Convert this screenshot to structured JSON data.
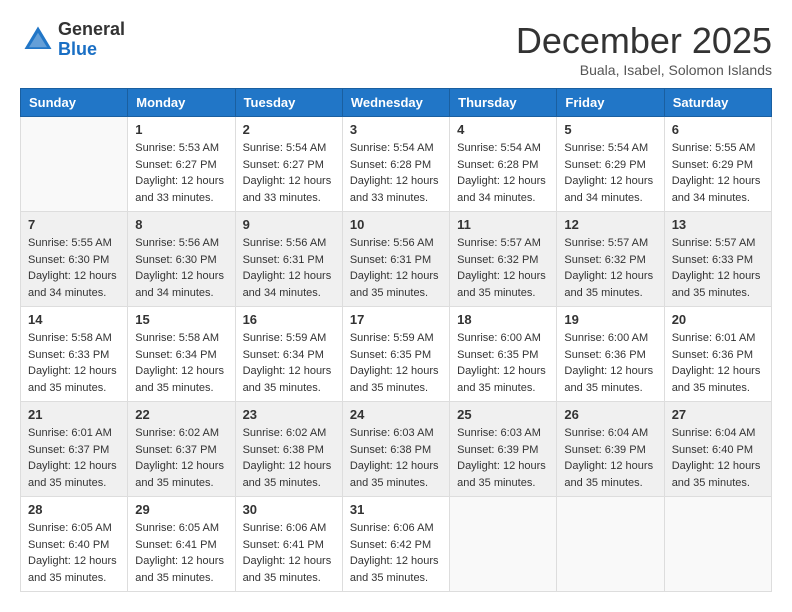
{
  "header": {
    "logo_line1": "General",
    "logo_line2": "Blue",
    "month": "December 2025",
    "location": "Buala, Isabel, Solomon Islands"
  },
  "days_of_week": [
    "Sunday",
    "Monday",
    "Tuesday",
    "Wednesday",
    "Thursday",
    "Friday",
    "Saturday"
  ],
  "weeks": [
    [
      {
        "day": "",
        "info": []
      },
      {
        "day": "1",
        "info": [
          "Sunrise: 5:53 AM",
          "Sunset: 6:27 PM",
          "Daylight: 12 hours",
          "and 33 minutes."
        ]
      },
      {
        "day": "2",
        "info": [
          "Sunrise: 5:54 AM",
          "Sunset: 6:27 PM",
          "Daylight: 12 hours",
          "and 33 minutes."
        ]
      },
      {
        "day": "3",
        "info": [
          "Sunrise: 5:54 AM",
          "Sunset: 6:28 PM",
          "Daylight: 12 hours",
          "and 33 minutes."
        ]
      },
      {
        "day": "4",
        "info": [
          "Sunrise: 5:54 AM",
          "Sunset: 6:28 PM",
          "Daylight: 12 hours",
          "and 34 minutes."
        ]
      },
      {
        "day": "5",
        "info": [
          "Sunrise: 5:54 AM",
          "Sunset: 6:29 PM",
          "Daylight: 12 hours",
          "and 34 minutes."
        ]
      },
      {
        "day": "6",
        "info": [
          "Sunrise: 5:55 AM",
          "Sunset: 6:29 PM",
          "Daylight: 12 hours",
          "and 34 minutes."
        ]
      }
    ],
    [
      {
        "day": "7",
        "info": [
          "Sunrise: 5:55 AM",
          "Sunset: 6:30 PM",
          "Daylight: 12 hours",
          "and 34 minutes."
        ]
      },
      {
        "day": "8",
        "info": [
          "Sunrise: 5:56 AM",
          "Sunset: 6:30 PM",
          "Daylight: 12 hours",
          "and 34 minutes."
        ]
      },
      {
        "day": "9",
        "info": [
          "Sunrise: 5:56 AM",
          "Sunset: 6:31 PM",
          "Daylight: 12 hours",
          "and 34 minutes."
        ]
      },
      {
        "day": "10",
        "info": [
          "Sunrise: 5:56 AM",
          "Sunset: 6:31 PM",
          "Daylight: 12 hours",
          "and 35 minutes."
        ]
      },
      {
        "day": "11",
        "info": [
          "Sunrise: 5:57 AM",
          "Sunset: 6:32 PM",
          "Daylight: 12 hours",
          "and 35 minutes."
        ]
      },
      {
        "day": "12",
        "info": [
          "Sunrise: 5:57 AM",
          "Sunset: 6:32 PM",
          "Daylight: 12 hours",
          "and 35 minutes."
        ]
      },
      {
        "day": "13",
        "info": [
          "Sunrise: 5:57 AM",
          "Sunset: 6:33 PM",
          "Daylight: 12 hours",
          "and 35 minutes."
        ]
      }
    ],
    [
      {
        "day": "14",
        "info": [
          "Sunrise: 5:58 AM",
          "Sunset: 6:33 PM",
          "Daylight: 12 hours",
          "and 35 minutes."
        ]
      },
      {
        "day": "15",
        "info": [
          "Sunrise: 5:58 AM",
          "Sunset: 6:34 PM",
          "Daylight: 12 hours",
          "and 35 minutes."
        ]
      },
      {
        "day": "16",
        "info": [
          "Sunrise: 5:59 AM",
          "Sunset: 6:34 PM",
          "Daylight: 12 hours",
          "and 35 minutes."
        ]
      },
      {
        "day": "17",
        "info": [
          "Sunrise: 5:59 AM",
          "Sunset: 6:35 PM",
          "Daylight: 12 hours",
          "and 35 minutes."
        ]
      },
      {
        "day": "18",
        "info": [
          "Sunrise: 6:00 AM",
          "Sunset: 6:35 PM",
          "Daylight: 12 hours",
          "and 35 minutes."
        ]
      },
      {
        "day": "19",
        "info": [
          "Sunrise: 6:00 AM",
          "Sunset: 6:36 PM",
          "Daylight: 12 hours",
          "and 35 minutes."
        ]
      },
      {
        "day": "20",
        "info": [
          "Sunrise: 6:01 AM",
          "Sunset: 6:36 PM",
          "Daylight: 12 hours",
          "and 35 minutes."
        ]
      }
    ],
    [
      {
        "day": "21",
        "info": [
          "Sunrise: 6:01 AM",
          "Sunset: 6:37 PM",
          "Daylight: 12 hours",
          "and 35 minutes."
        ]
      },
      {
        "day": "22",
        "info": [
          "Sunrise: 6:02 AM",
          "Sunset: 6:37 PM",
          "Daylight: 12 hours",
          "and 35 minutes."
        ]
      },
      {
        "day": "23",
        "info": [
          "Sunrise: 6:02 AM",
          "Sunset: 6:38 PM",
          "Daylight: 12 hours",
          "and 35 minutes."
        ]
      },
      {
        "day": "24",
        "info": [
          "Sunrise: 6:03 AM",
          "Sunset: 6:38 PM",
          "Daylight: 12 hours",
          "and 35 minutes."
        ]
      },
      {
        "day": "25",
        "info": [
          "Sunrise: 6:03 AM",
          "Sunset: 6:39 PM",
          "Daylight: 12 hours",
          "and 35 minutes."
        ]
      },
      {
        "day": "26",
        "info": [
          "Sunrise: 6:04 AM",
          "Sunset: 6:39 PM",
          "Daylight: 12 hours",
          "and 35 minutes."
        ]
      },
      {
        "day": "27",
        "info": [
          "Sunrise: 6:04 AM",
          "Sunset: 6:40 PM",
          "Daylight: 12 hours",
          "and 35 minutes."
        ]
      }
    ],
    [
      {
        "day": "28",
        "info": [
          "Sunrise: 6:05 AM",
          "Sunset: 6:40 PM",
          "Daylight: 12 hours",
          "and 35 minutes."
        ]
      },
      {
        "day": "29",
        "info": [
          "Sunrise: 6:05 AM",
          "Sunset: 6:41 PM",
          "Daylight: 12 hours",
          "and 35 minutes."
        ]
      },
      {
        "day": "30",
        "info": [
          "Sunrise: 6:06 AM",
          "Sunset: 6:41 PM",
          "Daylight: 12 hours",
          "and 35 minutes."
        ]
      },
      {
        "day": "31",
        "info": [
          "Sunrise: 6:06 AM",
          "Sunset: 6:42 PM",
          "Daylight: 12 hours",
          "and 35 minutes."
        ]
      },
      {
        "day": "",
        "info": []
      },
      {
        "day": "",
        "info": []
      },
      {
        "day": "",
        "info": []
      }
    ]
  ]
}
